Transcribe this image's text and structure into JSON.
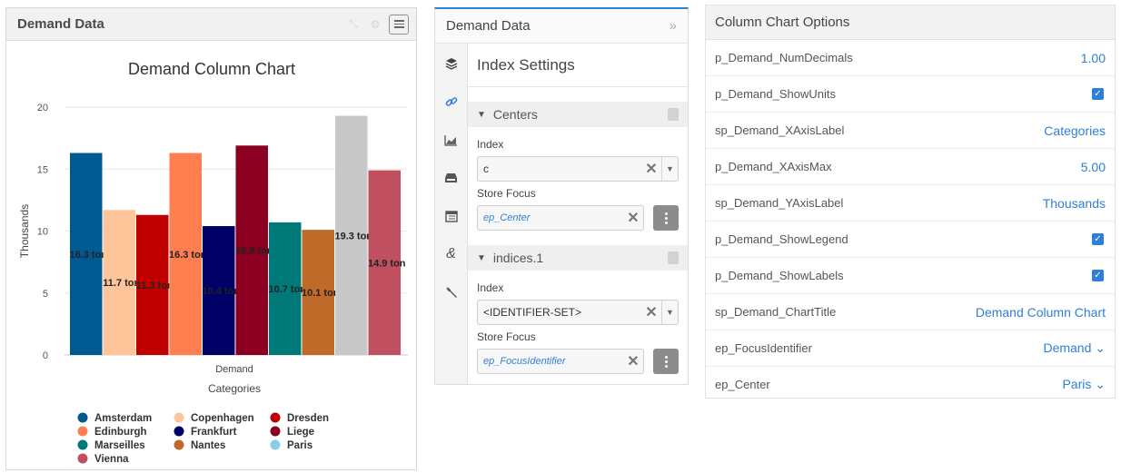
{
  "chart_widget": {
    "title": "Demand Data"
  },
  "chart_data": {
    "type": "bar",
    "title": "Demand Column Chart",
    "xlabel": "Categories",
    "ylabel": "Thousands",
    "category": "Demand",
    "ylim": [
      0,
      20
    ],
    "yticks": [
      "0",
      "5",
      "10",
      "15",
      "20"
    ],
    "grid": true,
    "legend_position": "bottom",
    "series": [
      {
        "name": "Amsterdam",
        "value": 16.3,
        "label": "16.3 ton",
        "color": "#005a92"
      },
      {
        "name": "Copenhagen",
        "value": 11.7,
        "label": "11.7 ton",
        "color": "#ffc59a"
      },
      {
        "name": "Dresden",
        "value": 11.3,
        "label": "11.3 ton",
        "color": "#c00000"
      },
      {
        "name": "Edinburgh",
        "value": 16.3,
        "label": "16.3 ton",
        "color": "#ff7f50"
      },
      {
        "name": "Frankfurt",
        "value": 10.4,
        "label": "10.4 ton",
        "color": "#000066"
      },
      {
        "name": "Liege",
        "value": 16.9,
        "label": "16.9 ton",
        "color": "#8b0020"
      },
      {
        "name": "Marseilles",
        "value": 10.7,
        "label": "10.7 ton",
        "color": "#007a78"
      },
      {
        "name": "Nantes",
        "value": 10.1,
        "label": "10.1 ton",
        "color": "#c06a2a"
      },
      {
        "name": "Paris",
        "value": 19.3,
        "label": "19.3 ton",
        "color": "#c8c8c8",
        "legend_color": "#87ceeb"
      },
      {
        "name": "Vienna",
        "value": 14.9,
        "label": "14.9 ton",
        "color": "#c05060"
      }
    ]
  },
  "settings_panel": {
    "title": "Demand Data",
    "collapse_icon": "double-chevron-right-icon",
    "heading": "Index Settings",
    "rail_icons": [
      "layers-icon",
      "link-icon",
      "area-chart-icon",
      "tray-icon",
      "table-icon",
      "ampersand-icon",
      "wrench-icon"
    ],
    "sections": [
      {
        "label": "Centers",
        "index_label": "Index",
        "index_value": "c",
        "focus_label": "Store Focus",
        "focus_value": "ep_Center"
      },
      {
        "label": "indices.1",
        "index_label": "Index",
        "index_value": "<IDENTIFIER-SET>",
        "focus_label": "Store Focus",
        "focus_value": "ep_FocusIdentifier"
      }
    ]
  },
  "options_panel": {
    "title": "Column Chart Options",
    "rows": [
      {
        "name": "p_Demand_NumDecimals",
        "value": "1.00",
        "kind": "text"
      },
      {
        "name": "p_Demand_ShowUnits",
        "value": "",
        "kind": "checkbox",
        "checked": true
      },
      {
        "name": "sp_Demand_XAxisLabel",
        "value": "Categories",
        "kind": "text"
      },
      {
        "name": "p_Demand_XAxisMax",
        "value": "5.00",
        "kind": "text"
      },
      {
        "name": "sp_Demand_YAxisLabel",
        "value": "Thousands",
        "kind": "text"
      },
      {
        "name": "p_Demand_ShowLegend",
        "value": "",
        "kind": "checkbox",
        "checked": true
      },
      {
        "name": "p_Demand_ShowLabels",
        "value": "",
        "kind": "checkbox",
        "checked": true
      },
      {
        "name": "sp_Demand_ChartTitle",
        "value": "Demand Column Chart",
        "kind": "text"
      },
      {
        "name": "ep_FocusIdentifier",
        "value": "Demand ⌄",
        "kind": "dropdown"
      },
      {
        "name": "ep_Center",
        "value": "Paris ⌄",
        "kind": "dropdown"
      }
    ]
  }
}
